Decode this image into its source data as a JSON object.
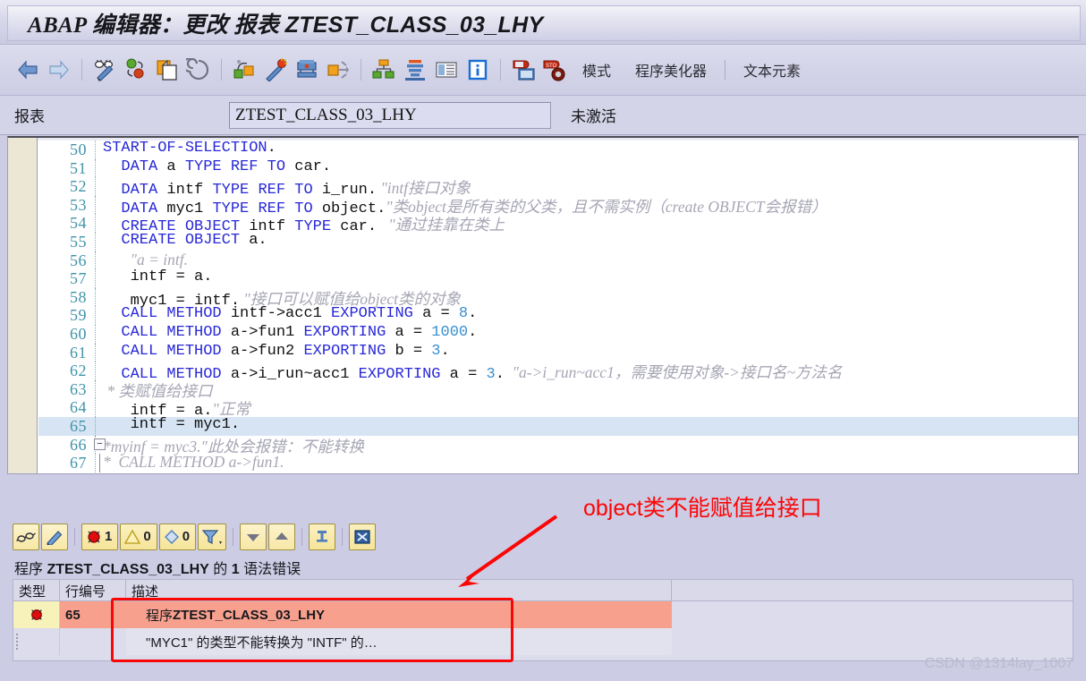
{
  "window": {
    "title_plain": "ABAP 编辑器：更改 报表 ",
    "title_object": "ZTEST_CLASS_03_LHY"
  },
  "toolbar": {
    "icons": [
      {
        "name": "back-arrow-icon",
        "label": "后退"
      },
      {
        "name": "forward-arrow-icon",
        "label": "前进"
      },
      {
        "name": "display-change-icon",
        "label": "显示 <-> 更改"
      },
      {
        "name": "other-object-icon",
        "label": "其它对象"
      },
      {
        "name": "copy-icon",
        "label": "复制"
      },
      {
        "name": "pattern-icon",
        "label": "样式"
      },
      {
        "name": "check-icon",
        "label": "检查"
      },
      {
        "name": "pretty-printer-icon",
        "label": "美化"
      },
      {
        "name": "activate-icon",
        "label": "激活"
      },
      {
        "name": "direct-processing-icon",
        "label": "直接处理"
      },
      {
        "name": "object-list-icon",
        "label": "对象列表"
      },
      {
        "name": "stack-icon",
        "label": "堆栈"
      },
      {
        "name": "where-used-icon",
        "label": "使用列表"
      },
      {
        "name": "info-icon",
        "label": "信息"
      },
      {
        "name": "debug-icon",
        "label": "调试"
      },
      {
        "name": "stop-debug-icon",
        "label": "停止"
      }
    ],
    "text_items": [
      "模式",
      "程序美化器",
      "文本元素"
    ]
  },
  "report_bar": {
    "label": "报表",
    "value": "ZTEST_CLASS_03_LHY",
    "status": "未激活"
  },
  "editor": {
    "first_line": 50,
    "highlight_line": 65,
    "lines": [
      {
        "n": 50,
        "segs": [
          {
            "t": "",
            "c": "sp0"
          },
          {
            "t": "START-OF-SELECTION",
            "c": "kw"
          },
          {
            "t": ".",
            "c": "p"
          }
        ]
      },
      {
        "n": 51,
        "segs": [
          {
            "t": "  ",
            "c": "p"
          },
          {
            "t": "DATA",
            "c": "kw"
          },
          {
            "t": " a ",
            "c": "p"
          },
          {
            "t": "TYPE REF TO",
            "c": "kw"
          },
          {
            "t": " car.",
            "c": "p"
          }
        ]
      },
      {
        "n": 52,
        "segs": [
          {
            "t": "  ",
            "c": "p"
          },
          {
            "t": "DATA",
            "c": "kw"
          },
          {
            "t": " intf ",
            "c": "p"
          },
          {
            "t": "TYPE REF TO",
            "c": "kw"
          },
          {
            "t": " i_run.",
            "c": "p"
          },
          {
            "t": " \"intf接口对象",
            "c": "cm"
          }
        ]
      },
      {
        "n": 53,
        "segs": [
          {
            "t": "  ",
            "c": "p"
          },
          {
            "t": "DATA",
            "c": "kw"
          },
          {
            "t": " myc1 ",
            "c": "p"
          },
          {
            "t": "TYPE REF TO",
            "c": "kw"
          },
          {
            "t": " object.",
            "c": "p"
          },
          {
            "t": "\"类object是所有类的父类，且不需实例（create OBJECT会报错）",
            "c": "cm"
          }
        ]
      },
      {
        "n": 54,
        "segs": [
          {
            "t": "  ",
            "c": "p"
          },
          {
            "t": "CREATE OBJECT",
            "c": "kw"
          },
          {
            "t": " intf ",
            "c": "p"
          },
          {
            "t": "TYPE",
            "c": "kw"
          },
          {
            "t": " car.",
            "c": "p"
          },
          {
            "t": "   \"通过挂靠在类上",
            "c": "cm"
          }
        ]
      },
      {
        "n": 55,
        "segs": [
          {
            "t": "  ",
            "c": "p"
          },
          {
            "t": "CREATE OBJECT",
            "c": "kw"
          },
          {
            "t": " a.",
            "c": "p"
          }
        ]
      },
      {
        "n": 56,
        "segs": [
          {
            "t": "   ",
            "c": "p"
          },
          {
            "t": "\"a = intf.",
            "c": "cm"
          }
        ]
      },
      {
        "n": 57,
        "segs": [
          {
            "t": "   intf = a.",
            "c": "p"
          }
        ]
      },
      {
        "n": 58,
        "segs": [
          {
            "t": "   myc1 = intf.",
            "c": "p"
          },
          {
            "t": " \"接口可以赋值给object类的对象",
            "c": "cm"
          }
        ]
      },
      {
        "n": 59,
        "segs": [
          {
            "t": "  ",
            "c": "p"
          },
          {
            "t": "CALL METHOD",
            "c": "kw"
          },
          {
            "t": " intf->acc1 ",
            "c": "p"
          },
          {
            "t": "EXPORTING",
            "c": "kw"
          },
          {
            "t": " a = ",
            "c": "p"
          },
          {
            "t": "8",
            "c": "num"
          },
          {
            "t": ".",
            "c": "p"
          }
        ]
      },
      {
        "n": 60,
        "segs": [
          {
            "t": "  ",
            "c": "p"
          },
          {
            "t": "CALL METHOD",
            "c": "kw"
          },
          {
            "t": " a->fun1 ",
            "c": "p"
          },
          {
            "t": "EXPORTING",
            "c": "kw"
          },
          {
            "t": " a = ",
            "c": "p"
          },
          {
            "t": "1000",
            "c": "num"
          },
          {
            "t": ".",
            "c": "p"
          }
        ]
      },
      {
        "n": 61,
        "segs": [
          {
            "t": "  ",
            "c": "p"
          },
          {
            "t": "CALL METHOD",
            "c": "kw"
          },
          {
            "t": " a->fun2 ",
            "c": "p"
          },
          {
            "t": "EXPORTING",
            "c": "kw"
          },
          {
            "t": " b = ",
            "c": "p"
          },
          {
            "t": "3",
            "c": "num"
          },
          {
            "t": ".",
            "c": "p"
          }
        ]
      },
      {
        "n": 62,
        "segs": [
          {
            "t": "  ",
            "c": "p"
          },
          {
            "t": "CALL METHOD",
            "c": "kw"
          },
          {
            "t": " a->i_run~acc1 ",
            "c": "p"
          },
          {
            "t": "EXPORTING",
            "c": "kw"
          },
          {
            "t": " a = ",
            "c": "p"
          },
          {
            "t": "3",
            "c": "num"
          },
          {
            "t": ".",
            "c": "p"
          },
          {
            "t": "  \"a->i_run~acc1，需要使用对象->接口名~方法名",
            "c": "cm"
          }
        ]
      },
      {
        "n": 63,
        "segs": [
          {
            "t": " * 类赋值给接口",
            "c": "cm"
          }
        ]
      },
      {
        "n": 64,
        "segs": [
          {
            "t": "   intf = a.",
            "c": "p"
          },
          {
            "t": "\"正常",
            "c": "cm"
          }
        ]
      },
      {
        "n": 65,
        "segs": [
          {
            "t": "   intf = myc1.",
            "c": "p"
          }
        ]
      },
      {
        "n": 66,
        "segs": [
          {
            "t": "*myinf = myc3.",
            "c": "cm"
          },
          {
            "t": "\"此处会报错：不能转换",
            "c": "cm"
          }
        ],
        "fold": "minus"
      },
      {
        "n": 67,
        "segs": [
          {
            "t": "*  CALL METHOD a->fun1.",
            "c": "cm"
          }
        ],
        "fold": "bar"
      }
    ]
  },
  "bottom_panel": {
    "buttons": [
      {
        "name": "display-source-button",
        "label": "显示源代码"
      },
      {
        "name": "edit-button",
        "label": "编辑"
      },
      {
        "name": "error-filter-button",
        "label": "错误",
        "count": "1"
      },
      {
        "name": "warning-filter-button",
        "label": "警告",
        "count": "0"
      },
      {
        "name": "info-filter-button",
        "label": "信息",
        "count": "0"
      },
      {
        "name": "filter-button",
        "label": "过滤器"
      },
      {
        "name": "next-message-button",
        "label": "下一条"
      },
      {
        "name": "previous-message-button",
        "label": "上一条"
      },
      {
        "name": "pin-button",
        "label": "固定"
      },
      {
        "name": "close-button",
        "label": "关闭"
      }
    ],
    "summary_prefix": "程序 ",
    "summary_program": "ZTEST_CLASS_03_LHY",
    "summary_middle": " 的 ",
    "summary_count": "1",
    "summary_suffix": " 语法错误",
    "columns": [
      "类型",
      "行编号",
      "描述"
    ],
    "rows": [
      {
        "icon": "error-icon",
        "line": "65",
        "desc_line1_prefix": "程序 ",
        "desc_line1_program": "ZTEST_CLASS_03_LHY",
        "desc_line2": "\"MYC1\" 的类型不能转换为 \"INTF\" 的…"
      }
    ]
  },
  "annotation": {
    "text": "object类不能赋值给接口",
    "color": "#fb0606"
  },
  "watermark": "CSDN @1314lay_1007"
}
